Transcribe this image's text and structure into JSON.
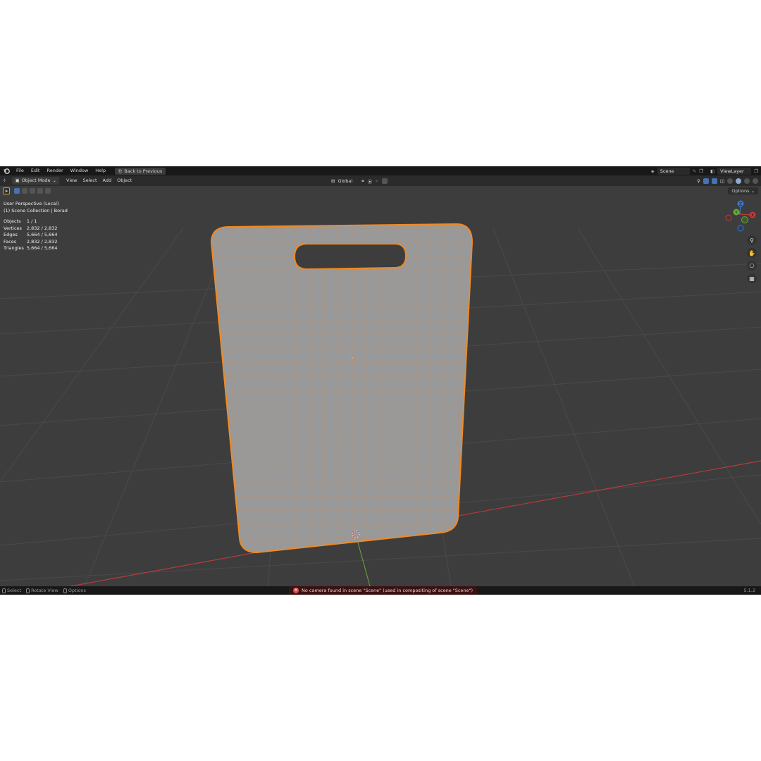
{
  "menu": {
    "items": [
      "File",
      "Edit",
      "Render",
      "Window",
      "Help"
    ],
    "back_button": "Back to Previous"
  },
  "scene": {
    "name": "Scene",
    "view_layer": "ViewLayer"
  },
  "header": {
    "mode": "Object Mode",
    "items": [
      "View",
      "Select",
      "Add",
      "Object"
    ],
    "transform_orientation": "Global",
    "options": "Options"
  },
  "viewport": {
    "perspective": "User Perspective (Local)",
    "collection": "(1) Scene Collection | Borad",
    "stats": [
      {
        "label": "Objects",
        "value": "1 / 1"
      },
      {
        "label": "Vertices",
        "value": "2,832 / 2,832"
      },
      {
        "label": "Edges",
        "value": "5,664 / 5,664"
      },
      {
        "label": "Faces",
        "value": "2,832 / 2,832"
      },
      {
        "label": "Triangles",
        "value": "5,664 / 5,664"
      }
    ],
    "gizmo": {
      "x": "X",
      "y": "Y",
      "z": "Z"
    }
  },
  "status": {
    "items": [
      "Select",
      "Rotate View",
      "Options"
    ],
    "warning": "No camera found in scene \"Scene\" (used in compositing of scene \"Scene\")",
    "version": "5.1.2"
  },
  "colors": {
    "viewport_bg": "#3d3d3d",
    "selection_outline": "#f08a24",
    "mesh_face": "#9a9a9a",
    "x_axis": "#c23a3a",
    "y_axis": "#6aa83a",
    "z_axis": "#3a78c8"
  }
}
